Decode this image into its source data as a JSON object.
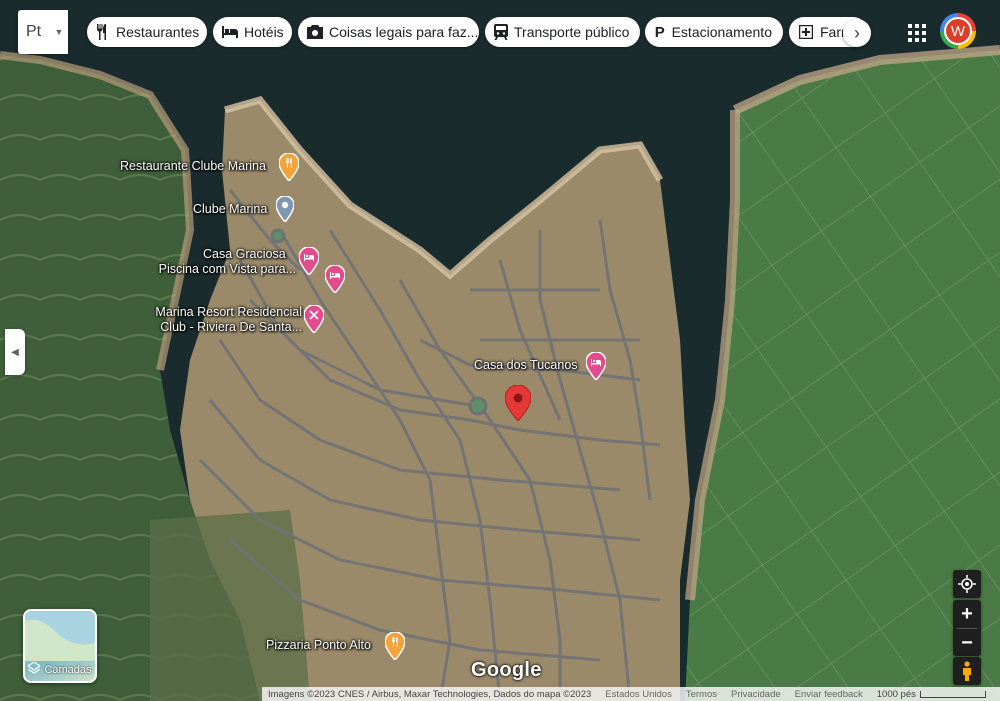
{
  "language_button": {
    "label": "Pt"
  },
  "filters": [
    {
      "label": "Restaurantes",
      "icon": "fork-knife-icon"
    },
    {
      "label": "Hotéis",
      "icon": "bed-icon"
    },
    {
      "label": "Coisas legais para faz...",
      "icon": "camera-icon"
    },
    {
      "label": "Transporte público",
      "icon": "train-icon"
    },
    {
      "label": "Estacionamento",
      "icon": "parking-icon"
    },
    {
      "label": "Farr",
      "icon": "pharmacy-icon"
    }
  ],
  "account": {
    "initial": "W"
  },
  "places": [
    {
      "name": "Restaurante Clube Marina",
      "type": "restaurant",
      "color": "#f2a33a"
    },
    {
      "name": "Clube Marina",
      "type": "place",
      "color": "#7f97b3"
    },
    {
      "name_line1": "Casa Graciosa",
      "name_line2": "Piscina com Vista para...",
      "type": "hotel",
      "color": "#e34c8c"
    },
    {
      "name_line1": "Marina Resort Residencial",
      "name_line2": "Club - Riviera De Santa...",
      "type": "hotel",
      "color": "#e34c8c"
    },
    {
      "name": "Casa dos Tucanos",
      "type": "hotel",
      "color": "#e34c8c"
    },
    {
      "name": "Pizzaria Ponto Alto",
      "type": "restaurant",
      "color": "#f2a33a"
    }
  ],
  "layers": {
    "label": "Camadas"
  },
  "brand": "Google",
  "footer": {
    "attribution": "Imagens ©2023 CNES / Airbus, Maxar Technologies, Dados do mapa ©2023",
    "country": "Estados Unidos",
    "terms": "Termos",
    "privacy": "Privacidade",
    "feedback": "Enviar feedback",
    "scale": "1000 pés"
  },
  "colors": {
    "water": "#1a2b2d",
    "field": "#4f7d4b",
    "dry_land": "#a08b6a",
    "road": "#777a7c",
    "pin_red": "#e53935"
  }
}
